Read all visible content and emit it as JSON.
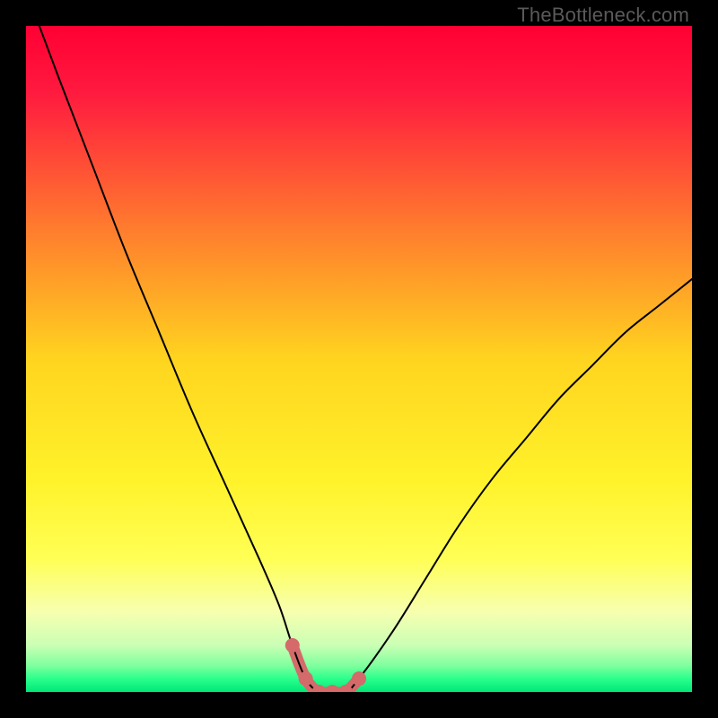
{
  "watermark": "TheBottleneck.com",
  "chart_data": {
    "type": "line",
    "title": "",
    "xlabel": "",
    "ylabel": "",
    "xlim": [
      0,
      100
    ],
    "ylim": [
      0,
      100
    ],
    "grid": false,
    "legend": false,
    "series": [
      {
        "name": "bottleneck-curve",
        "x": [
          2,
          5,
          10,
          15,
          20,
          25,
          30,
          35,
          38,
          40,
          42,
          44,
          46,
          48,
          50,
          55,
          60,
          65,
          70,
          75,
          80,
          85,
          90,
          95,
          100
        ],
        "y": [
          100,
          92,
          79,
          66,
          54,
          42,
          31,
          20,
          13,
          7,
          2,
          0,
          0,
          0,
          2,
          9,
          17,
          25,
          32,
          38,
          44,
          49,
          54,
          58,
          62
        ]
      },
      {
        "name": "highlight-band",
        "x": [
          40,
          42,
          44,
          46,
          48,
          50
        ],
        "y": [
          7,
          2,
          0,
          0,
          0,
          2
        ]
      }
    ],
    "gradient_stops": [
      {
        "offset": 0.0,
        "color": "#ff0033"
      },
      {
        "offset": 0.1,
        "color": "#ff1a3f"
      },
      {
        "offset": 0.3,
        "color": "#ff7a2e"
      },
      {
        "offset": 0.5,
        "color": "#ffd41f"
      },
      {
        "offset": 0.68,
        "color": "#fff22a"
      },
      {
        "offset": 0.8,
        "color": "#ffff55"
      },
      {
        "offset": 0.88,
        "color": "#f7ffb0"
      },
      {
        "offset": 0.93,
        "color": "#caffb5"
      },
      {
        "offset": 0.96,
        "color": "#80ff9e"
      },
      {
        "offset": 0.98,
        "color": "#2aff8c"
      },
      {
        "offset": 1.0,
        "color": "#00e878"
      }
    ],
    "highlight_color": "#d46a6a",
    "curve_color": "#000000"
  }
}
